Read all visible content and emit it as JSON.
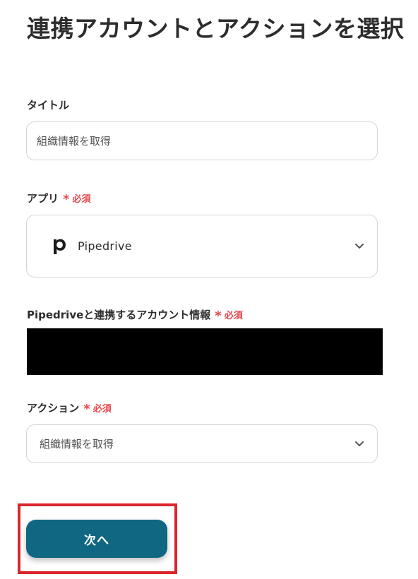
{
  "page": {
    "title": "連携アカウントとアクションを選択"
  },
  "fields": {
    "title": {
      "label": "タイトル",
      "value": "組織情報を取得"
    },
    "app": {
      "label": "アプリ",
      "required_label": "必須",
      "selected_app": "Pipedrive",
      "logo_letter": "p"
    },
    "account": {
      "label": "Pipedriveと連携するアカウント情報",
      "required_label": "必須"
    },
    "action": {
      "label": "アクション",
      "required_label": "必須",
      "value": "組織情報を取得"
    }
  },
  "buttons": {
    "next_label": "次へ"
  },
  "colors": {
    "primary_button": "#0f6782",
    "required_red": "#e5484d",
    "highlight_red": "#d9262c",
    "border_gray": "#d4d4d4"
  },
  "icons": {
    "dropdown": "chevron-down-icon",
    "required": "asterisk-icon",
    "app_logo": "pipedrive-logo-icon"
  }
}
